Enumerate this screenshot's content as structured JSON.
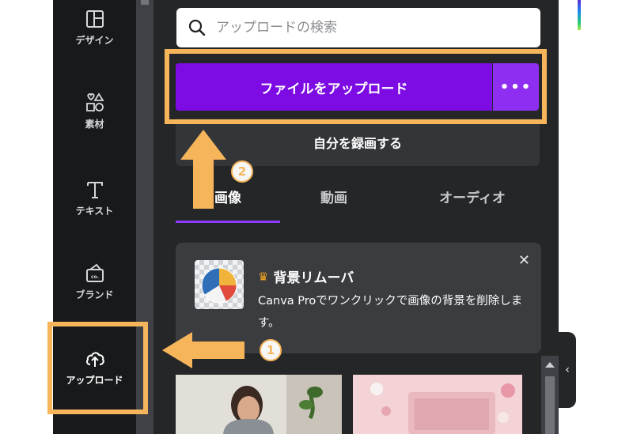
{
  "sidebar": {
    "items": [
      {
        "label": "デザイン",
        "icon": "layout-icon"
      },
      {
        "label": "素材",
        "icon": "shapes-icon"
      },
      {
        "label": "テキスト",
        "icon": "text-icon"
      },
      {
        "label": "ブランド",
        "icon": "brand-icon"
      },
      {
        "label": "アップロード",
        "icon": "cloud-upload-icon",
        "active": true
      }
    ]
  },
  "panel": {
    "search_placeholder": "アップロードの検索",
    "upload_button": "ファイルをアップロード",
    "more_button": "•••",
    "record_button": "自分を録画する",
    "tabs": [
      {
        "label": "画像",
        "active": true
      },
      {
        "label": "動画"
      },
      {
        "label": "オーディオ"
      }
    ],
    "promo": {
      "title": "背景リムーバ",
      "text": "Canva Proでワンクリックで画像の背景を削除します。",
      "close": "✕"
    }
  },
  "annotations": {
    "step1": "1",
    "step2": "2",
    "accent_color": "#f7b55b"
  },
  "colors": {
    "primary": "#7d0ce4",
    "panel_bg": "#252627",
    "rail_bg": "#18191b"
  }
}
